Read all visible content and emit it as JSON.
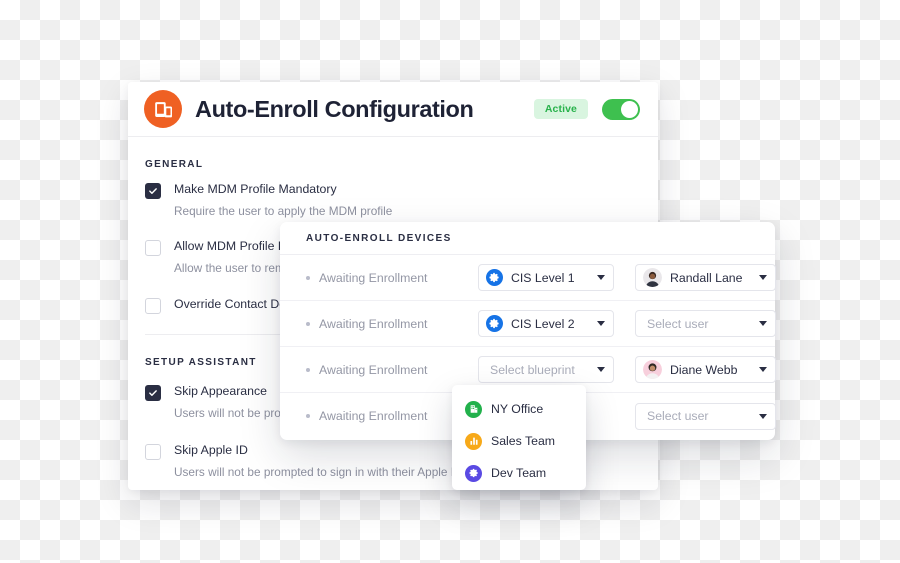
{
  "config_panel": {
    "logo_icon": "devices-icon",
    "title": "Auto-Enroll Configuration",
    "status_badge": "Active",
    "toggle_on": true,
    "accent_color": "#ef6023",
    "toggle_color": "#3ec04f",
    "badge_bg": "#d9f5e0",
    "badge_color": "#28b24b",
    "sections": [
      {
        "label": "GENERAL",
        "options": [
          {
            "checked": true,
            "title": "Make MDM Profile Mandatory",
            "subtitle": "Require the user to apply the MDM profile"
          },
          {
            "checked": false,
            "title": "Allow MDM Profile Removal",
            "subtitle": "Allow the user to remove the MDM profile"
          },
          {
            "checked": false,
            "title": "Override Contact Details",
            "subtitle": ""
          }
        ]
      },
      {
        "label": "SETUP ASSISTANT",
        "options": [
          {
            "checked": true,
            "title": "Skip Appearance",
            "subtitle": "Users will not be prompted to choose an appearance"
          },
          {
            "checked": false,
            "title": "Skip Apple ID",
            "subtitle": "Users will not be prompted to sign in with their Apple ID"
          }
        ]
      }
    ]
  },
  "devices_panel": {
    "header": "AUTO-ENROLL DEVICES",
    "rows": [
      {
        "status": "Awaiting Enrollment",
        "blueprint": {
          "label": "CIS Level 1",
          "placeholder": false,
          "icon": "gear-icon",
          "color": "#1673e6"
        },
        "user": {
          "label": "Randall Lane",
          "placeholder": false,
          "avatar": "avatar-randall-lane"
        }
      },
      {
        "status": "Awaiting Enrollment",
        "blueprint": {
          "label": "CIS Level 2",
          "placeholder": false,
          "icon": "gear-icon",
          "color": "#1673e6"
        },
        "user": {
          "label": "Select user",
          "placeholder": true,
          "avatar": ""
        }
      },
      {
        "status": "Awaiting Enrollment",
        "blueprint": {
          "label": "Select blueprint",
          "placeholder": true,
          "icon": "",
          "color": ""
        },
        "user": {
          "label": "Diane Webb",
          "placeholder": false,
          "avatar": "avatar-diane-webb"
        }
      },
      {
        "status": "Awaiting Enrollment",
        "blueprint": {
          "label": "",
          "placeholder": true,
          "icon": "",
          "color": ""
        },
        "user": {
          "label": "Select user",
          "placeholder": true,
          "avatar": ""
        }
      }
    ]
  },
  "blueprint_dropdown": {
    "open": true,
    "items": [
      {
        "label": "NY Office",
        "icon": "office-building-icon",
        "color": "#22b14c"
      },
      {
        "label": "Sales Team",
        "icon": "bar-chart-icon",
        "color": "#f7a919"
      },
      {
        "label": "Dev Team",
        "icon": "gear-icon",
        "color": "#5a4ae3"
      }
    ]
  }
}
